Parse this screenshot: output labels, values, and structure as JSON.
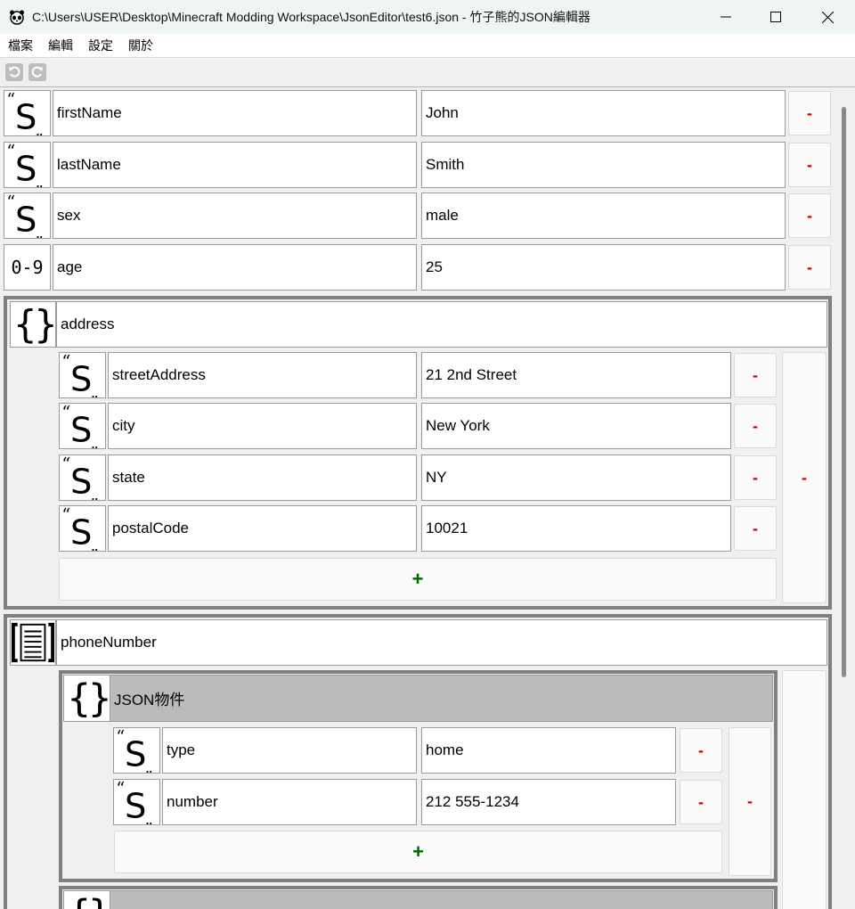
{
  "window": {
    "title": "C:\\Users\\USER\\Desktop\\Minecraft Modding Workspace\\JsonEditor\\test6.json - 竹子熊的JSON編輯器",
    "minimize_glyph": "—",
    "close_glyph": "✕"
  },
  "menu": [
    "檔案",
    "編輯",
    "設定",
    "關於"
  ],
  "toolbar": {
    "undo_icon": "undo-icon",
    "redo_icon": "redo-icon"
  },
  "colors": {
    "minus": "#d00000",
    "plus": "#006400",
    "border": "#808080",
    "header_gray": "#bbbbbb"
  },
  "buttons": {
    "minus": "-",
    "plus": "+"
  },
  "icons": {
    "string": "string-icon",
    "number": "number-icon",
    "object": "object-icon",
    "array": "array-icon"
  },
  "number_icon_text": "0-9",
  "root": {
    "fields": [
      {
        "type": "string",
        "key": "firstName",
        "value": "John"
      },
      {
        "type": "string",
        "key": "lastName",
        "value": "Smith"
      },
      {
        "type": "string",
        "key": "sex",
        "value": "male"
      },
      {
        "type": "number",
        "key": "age",
        "value": "25"
      }
    ],
    "address": {
      "key": "address",
      "fields": [
        {
          "type": "string",
          "key": "streetAddress",
          "value": "21 2nd Street"
        },
        {
          "type": "string",
          "key": "city",
          "value": "New York"
        },
        {
          "type": "string",
          "key": "state",
          "value": "NY"
        },
        {
          "type": "string",
          "key": "postalCode",
          "value": "10021"
        }
      ]
    },
    "phoneNumber": {
      "key": "phoneNumber",
      "items": [
        {
          "label": "JSON物件",
          "fields": [
            {
              "type": "string",
              "key": "type",
              "value": "home"
            },
            {
              "type": "string",
              "key": "number",
              "value": "212 555-1234"
            }
          ]
        }
      ]
    }
  }
}
